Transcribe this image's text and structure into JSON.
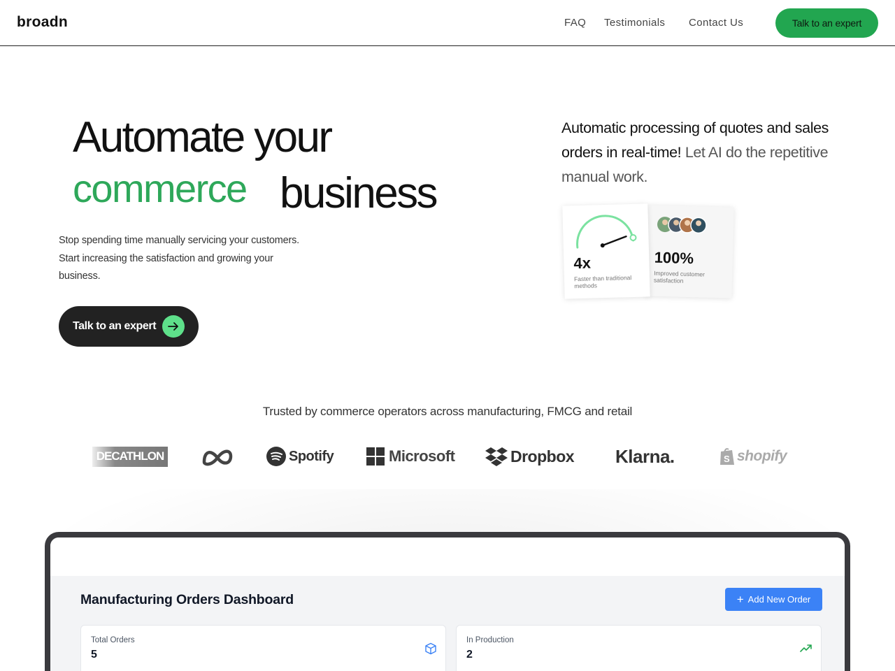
{
  "nav": {
    "logo": "broadn",
    "links": [
      "FAQ",
      "Testimonials",
      "Contact Us"
    ],
    "cta": "Talk to an expert",
    "cta_color": "#22a650"
  },
  "hero": {
    "line1": "Automate your",
    "highlight": "commerce",
    "line2_rest": "business",
    "highlight_color": "#2ea85a",
    "subtitle": "Stop spending time manually servicing your customers. Start increasing the satisfaction and growing your business.",
    "cta": "Talk to an expert",
    "right_copy_strong": "Automatic processing of quotes and sales orders in real-time!",
    "right_copy_muted": "Let AI do the repetitive manual work."
  },
  "stats": [
    {
      "value": "4x",
      "note": "Faster than traditional methods"
    },
    {
      "value": "100%",
      "note": "Improved customer satisfaction"
    }
  ],
  "trusted": {
    "heading": "Trusted by commerce operators across manufacturing, FMCG and retail",
    "brands": [
      "DECATHLON",
      "meta-logo",
      "Spotify",
      "Microsoft",
      "Dropbox",
      "Klarna.",
      "shopify"
    ]
  },
  "dashboard": {
    "title": "Manufacturing Orders Dashboard",
    "add_button": "Add New Order",
    "kpis": [
      {
        "label": "Total Orders",
        "value": "5",
        "icon": "cube-icon"
      },
      {
        "label": "In Production",
        "value": "2",
        "icon": "trending-up-icon"
      }
    ]
  }
}
